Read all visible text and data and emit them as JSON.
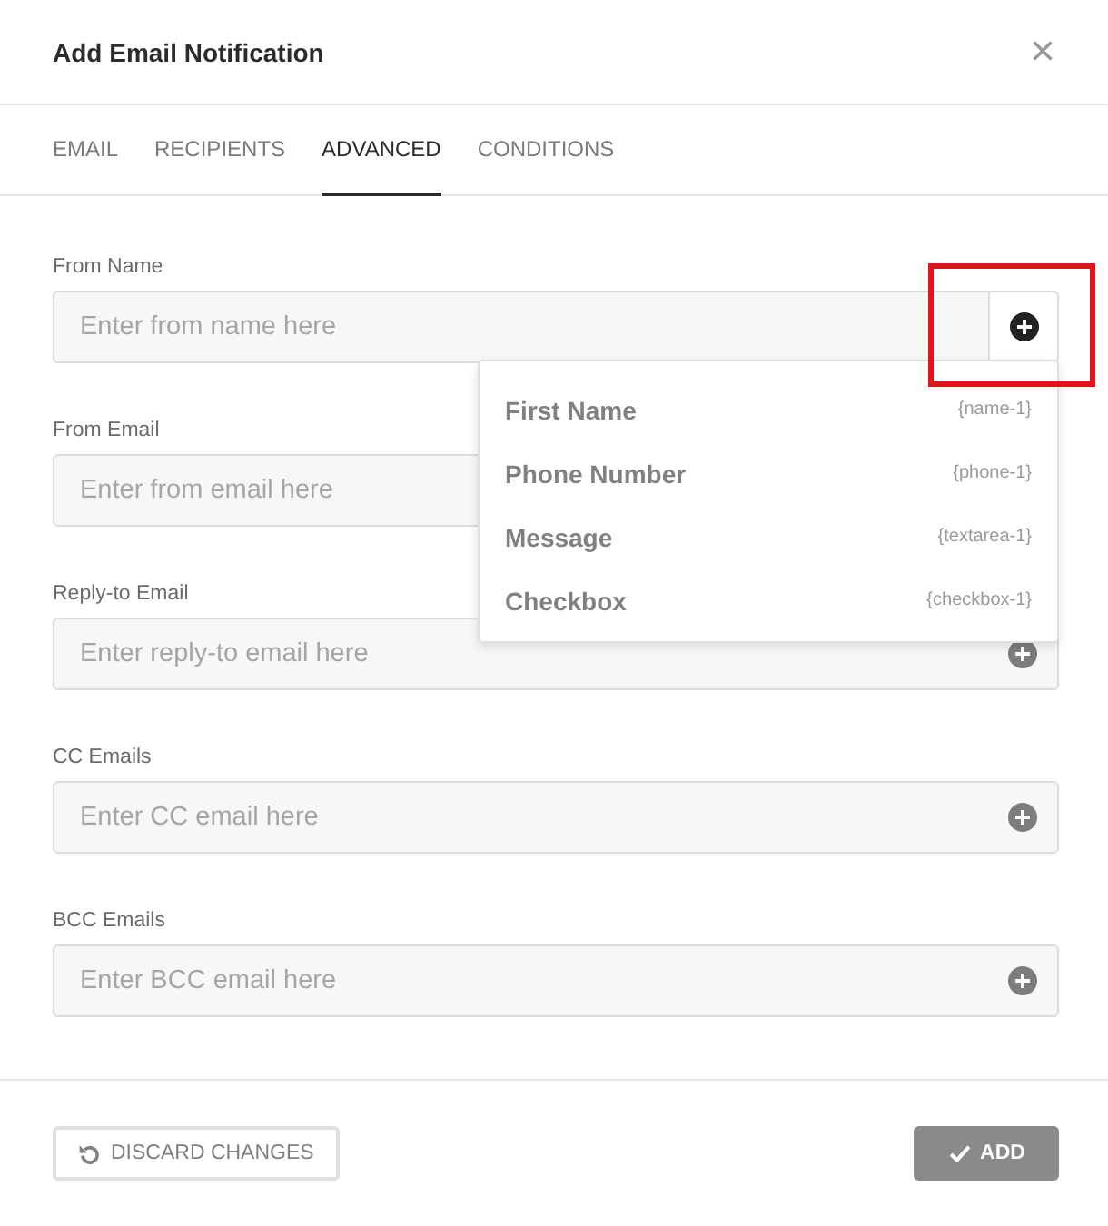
{
  "dialog": {
    "title": "Add Email Notification",
    "close": "×"
  },
  "tabs": [
    {
      "label": "EMAIL",
      "selected": false
    },
    {
      "label": "RECIPIENTS",
      "selected": false
    },
    {
      "label": "ADVANCED",
      "selected": true
    },
    {
      "label": "CONDITIONS",
      "selected": false
    }
  ],
  "fields": [
    {
      "label": "From Name",
      "placeholder": "Enter from name here",
      "expanded": true,
      "highlighted": true,
      "options": [
        {
          "label": "First Name",
          "tag": "{name-1}"
        },
        {
          "label": "Phone Number",
          "tag": "{phone-1}"
        },
        {
          "label": "Message",
          "tag": "{textarea-1}"
        },
        {
          "label": "Checkbox",
          "tag": "{checkbox-1}"
        }
      ]
    },
    {
      "label": "From Email",
      "placeholder": "Enter from email here",
      "expanded": false,
      "highlighted": false
    },
    {
      "label": "Reply-to Email",
      "placeholder": "Enter reply-to email here",
      "expanded": false,
      "highlighted": false
    },
    {
      "label": "CC Emails",
      "placeholder": "Enter CC email here",
      "expanded": false,
      "highlighted": false
    },
    {
      "label": "BCC Emails",
      "placeholder": "Enter BCC email here",
      "expanded": false,
      "highlighted": false
    }
  ],
  "buttons": [
    {
      "label": "DISCARD CHANGES",
      "kind": "discard"
    },
    {
      "label": "ADD",
      "kind": "add"
    }
  ]
}
